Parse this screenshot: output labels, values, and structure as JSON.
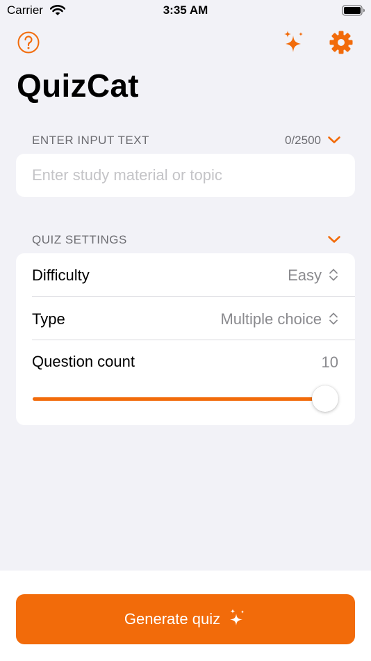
{
  "status_bar": {
    "carrier": "Carrier",
    "time": "3:35 AM"
  },
  "nav": {
    "help_icon": "question-circle-icon",
    "sparkle_icon": "sparkles-icon",
    "settings_icon": "gear-icon"
  },
  "app_title": "QuizCat",
  "input_section": {
    "header": "ENTER INPUT TEXT",
    "counter": "0/2500",
    "value": "",
    "placeholder": "Enter study material or topic"
  },
  "settings_section": {
    "header": "QUIZ SETTINGS",
    "difficulty": {
      "label": "Difficulty",
      "value": "Easy"
    },
    "type": {
      "label": "Type",
      "value": "Multiple choice"
    },
    "question_count": {
      "label": "Question count",
      "value": "10",
      "slider_fraction": 1.0
    }
  },
  "generate_button": {
    "label": "Generate quiz"
  },
  "colors": {
    "accent": "#f26b0a",
    "background": "#f2f2f7",
    "card": "#ffffff",
    "secondary_text": "#6d6d72"
  }
}
